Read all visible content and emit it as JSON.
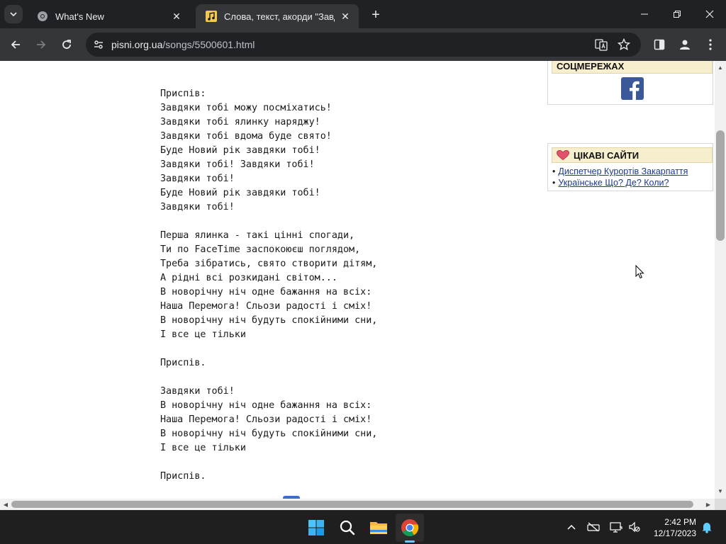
{
  "browser": {
    "tabs": [
      {
        "title": "What's New",
        "icon": "chrome-icon"
      },
      {
        "title": "Слова, текст, акорди \"Завдяки",
        "icon": "music-note-icon"
      }
    ],
    "address": {
      "host": "pisni.org.ua",
      "path": "/songs/5500601.html"
    }
  },
  "lyrics": [
    "Приспів:",
    "Завдяки тобі можу посміхатись!",
    "Завдяки тобі ялинку наряджу!",
    "Завдяки тобі вдома буде свято!",
    "Буде Новий рік завдяки тобі!",
    "Завдяки тобі! Завдяки тобі!",
    "Завдяки тобі!",
    "Буде Новий рік завдяки тобі!",
    "Завдяки тобі!",
    "",
    "Перша ялинка - такі цінні спогади,",
    "Ти по FaceTime заспокоюєш поглядом,",
    "Треба зібратись, свято створити дітям,",
    "А рідні всі розкидані світом...",
    "В новорічну ніч одне бажання на всіх:",
    "Наша Перемога! Сльози радості і сміх!",
    "В новорічну ніч будуть спокійними сни,",
    "І все це тільки",
    "",
    "Приспів.",
    "",
    "Завдяки тобі!",
    "В новорічну ніч одне бажання на всіх:",
    "Наша Перемога! Сльози радості і сміх!",
    "В новорічну ніч будуть спокійними сни,",
    "І все це тільки",
    "",
    "Приспів."
  ],
  "sidebar": {
    "social": {
      "title": "СОЦМЕРЕЖАХ",
      "icon": "facebook-icon"
    },
    "sites": {
      "title": "ЦІКАВІ САЙТИ",
      "icon": "heart-icon",
      "links": [
        "Диспетчер Курортів Закарпаття",
        "Українське Що? Де? Коли?"
      ]
    }
  },
  "taskbar": {
    "apps": [
      "windows-start-icon",
      "search-icon",
      "file-explorer-icon",
      "chrome-icon"
    ],
    "time": "2:42 PM",
    "date": "12/17/2023"
  },
  "colors": {
    "accent": "#60cdff",
    "sidebar_header": "#f6eecd",
    "facebook": "#3b5998"
  }
}
